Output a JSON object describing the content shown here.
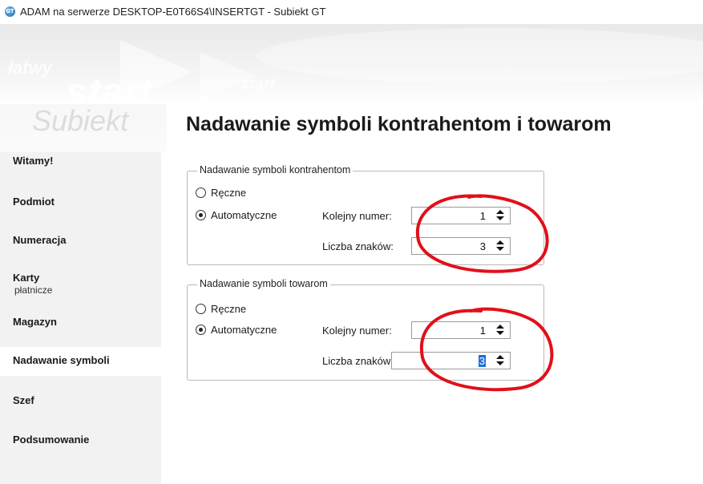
{
  "window": {
    "title": "ADAM na serwerze DESKTOP-E0T66S4\\INSERTGT - Subiekt GT",
    "icon": "subiekt-gt-app-icon"
  },
  "banner": {
    "words": [
      "łatwy",
      "start",
      "start",
      "Subiekt"
    ]
  },
  "sidebar": {
    "items": [
      {
        "label": "Witamy!",
        "sub": ""
      },
      {
        "label": "Podmiot",
        "sub": ""
      },
      {
        "label": "Numeracja",
        "sub": ""
      },
      {
        "label": "Karty",
        "sub": "płatnicze"
      },
      {
        "label": "Magazyn",
        "sub": ""
      },
      {
        "label": "Nadawanie symboli",
        "sub": "",
        "active": true
      },
      {
        "label": "Szef",
        "sub": ""
      },
      {
        "label": "Podsumowanie",
        "sub": ""
      }
    ]
  },
  "page": {
    "title": "Nadawanie symboli kontrahentom i towarom"
  },
  "groups": [
    {
      "title": "Nadawanie symboli kontrahentom",
      "options": {
        "manual": "Ręczne",
        "auto": "Automatyczne",
        "selected": "auto"
      },
      "next_number_label": "Kolejny numer:",
      "next_number_value": "1",
      "char_count_label": "Liczba znaków:",
      "char_count_value": "3"
    },
    {
      "title": "Nadawanie symboli towarom",
      "options": {
        "manual": "Ręczne",
        "auto": "Automatyczne",
        "selected": "auto"
      },
      "next_number_label": "Kolejny numer:",
      "next_number_value": "1",
      "char_count_label": "Liczba znaków:",
      "char_count_value": "3"
    }
  ],
  "colors": {
    "annotation": "#e0101a",
    "selection": "#1e6fd9",
    "sidebar_bg": "#f2f2f2"
  }
}
